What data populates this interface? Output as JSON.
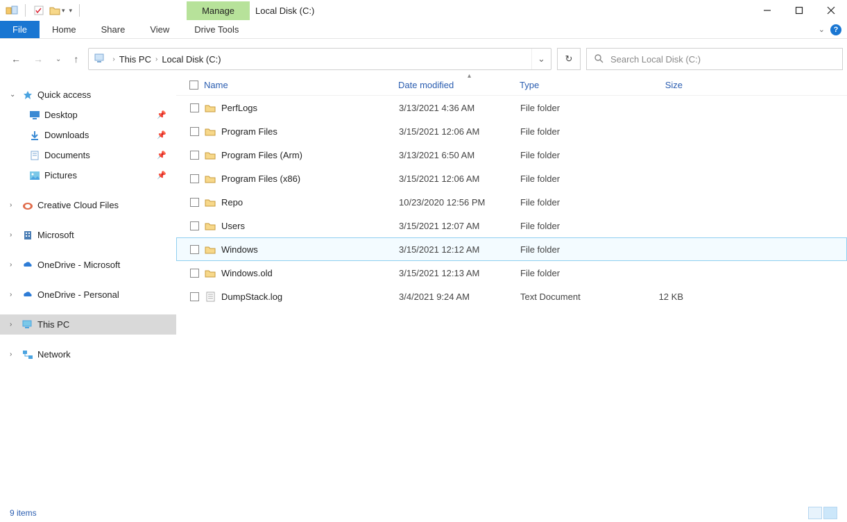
{
  "window": {
    "title": "Local Disk (C:)"
  },
  "ribbon": {
    "manage": "Manage",
    "file": "File",
    "home": "Home",
    "share": "Share",
    "view": "View",
    "drive_tools": "Drive Tools"
  },
  "address": {
    "crumb1": "This PC",
    "crumb2": "Local Disk (C:)"
  },
  "search": {
    "placeholder": "Search Local Disk (C:)"
  },
  "columns": {
    "name": "Name",
    "date": "Date modified",
    "type": "Type",
    "size": "Size"
  },
  "sidebar": {
    "quick_access": "Quick access",
    "desktop": "Desktop",
    "downloads": "Downloads",
    "documents": "Documents",
    "pictures": "Pictures",
    "creative_cloud": "Creative Cloud Files",
    "microsoft": "Microsoft",
    "onedrive_ms": "OneDrive - Microsoft",
    "onedrive_personal": "OneDrive - Personal",
    "this_pc": "This PC",
    "network": "Network"
  },
  "rows": [
    {
      "name": "PerfLogs",
      "date": "3/13/2021 4:36 AM",
      "type": "File folder",
      "size": "",
      "icon": "folder"
    },
    {
      "name": "Program Files",
      "date": "3/15/2021 12:06 AM",
      "type": "File folder",
      "size": "",
      "icon": "folder"
    },
    {
      "name": "Program Files (Arm)",
      "date": "3/13/2021 6:50 AM",
      "type": "File folder",
      "size": "",
      "icon": "folder"
    },
    {
      "name": "Program Files (x86)",
      "date": "3/15/2021 12:06 AM",
      "type": "File folder",
      "size": "",
      "icon": "folder"
    },
    {
      "name": "Repo",
      "date": "10/23/2020 12:56 PM",
      "type": "File folder",
      "size": "",
      "icon": "folder"
    },
    {
      "name": "Users",
      "date": "3/15/2021 12:07 AM",
      "type": "File folder",
      "size": "",
      "icon": "folder"
    },
    {
      "name": "Windows",
      "date": "3/15/2021 12:12 AM",
      "type": "File folder",
      "size": "",
      "icon": "folder",
      "highlight": true
    },
    {
      "name": "Windows.old",
      "date": "3/15/2021 12:13 AM",
      "type": "File folder",
      "size": "",
      "icon": "folder"
    },
    {
      "name": "DumpStack.log",
      "date": "3/4/2021 9:24 AM",
      "type": "Text Document",
      "size": "12 KB",
      "icon": "textfile"
    }
  ],
  "status": {
    "items": "9 items"
  }
}
